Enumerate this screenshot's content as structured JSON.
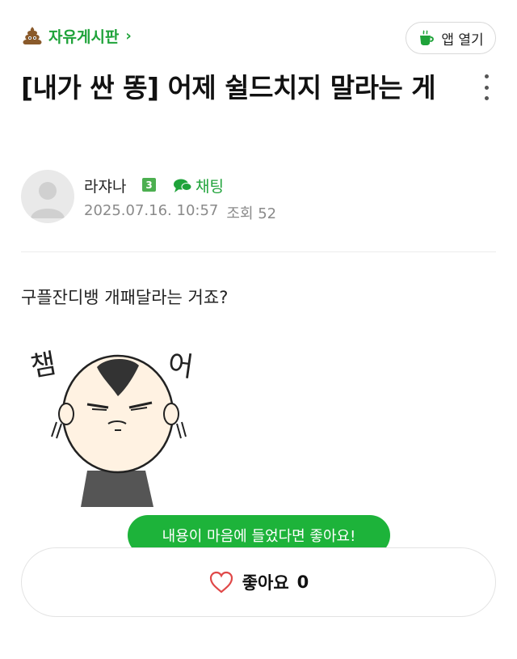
{
  "header": {
    "board_name": "자유게시판",
    "app_open_label": "앱 열기"
  },
  "post": {
    "title": "[내가 싼 똥] 어제 쉴드치지 말라는 게",
    "author": "라쟈나",
    "author_level": "3",
    "chat_label": "채팅",
    "date": "2025.07.16. 10:57",
    "views": "조회 52",
    "body": "구플잔디뱅 개패달라는 거죠?",
    "sticker_text_left": "챔",
    "sticker_text_right": "어"
  },
  "like": {
    "tooltip": "내용이 마음에 들었다면 좋아요!",
    "label": "좋아요",
    "count": "0"
  },
  "colors": {
    "accent_green": "#1fa33a",
    "tooltip_green": "#1db33a"
  },
  "icons": [
    "poop-icon",
    "chevron-right-icon",
    "cup-icon",
    "kebab-menu-icon",
    "chat-bubble-icon",
    "heart-icon"
  ]
}
